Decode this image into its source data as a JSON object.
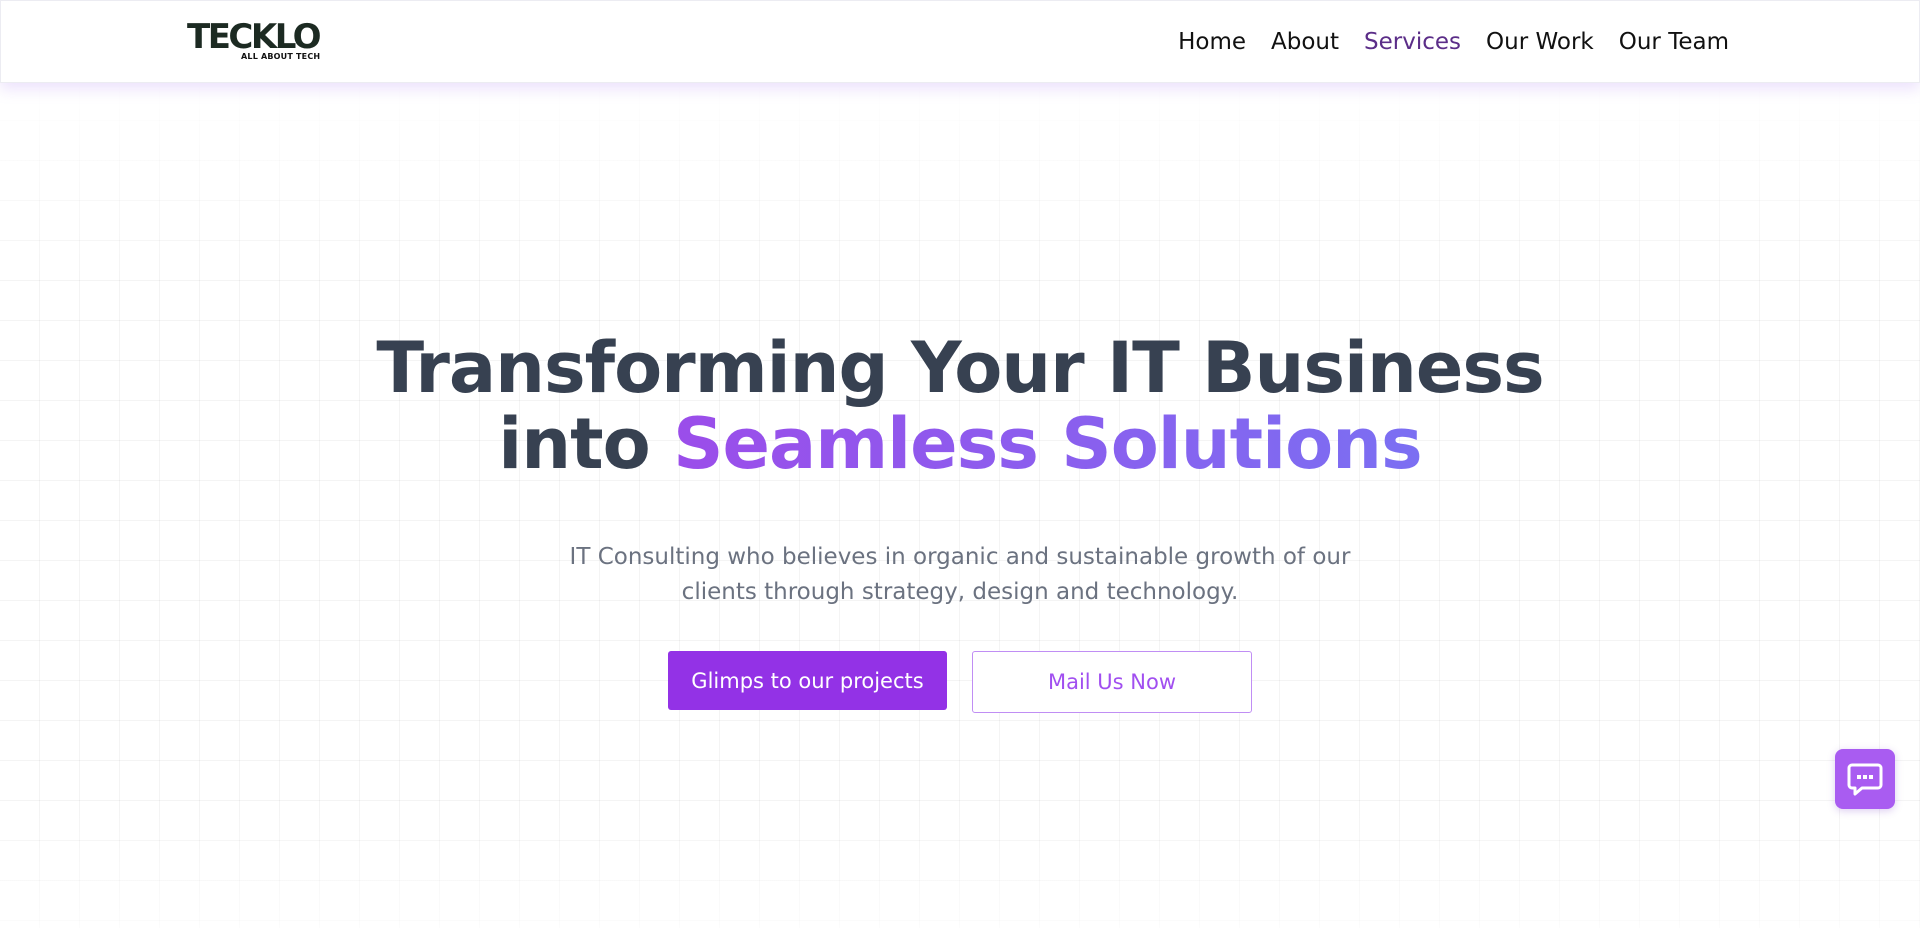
{
  "brand": {
    "logo_text": "TECKLO",
    "tagline": "ALL ABOUT TECH"
  },
  "nav": {
    "items": [
      {
        "label": "Home"
      },
      {
        "label": "About"
      },
      {
        "label": "Services",
        "active": true
      },
      {
        "label": "Our Work"
      },
      {
        "label": "Our Team"
      }
    ]
  },
  "hero": {
    "title_line1": "Transforming Your IT Business",
    "title_line2_prefix": "into",
    "title_highlight": "Seamless Solutions",
    "subtitle_line1": "IT Consulting who believes in organic and sustainable growth of our",
    "subtitle_line2": "clients through strategy, design and technology.",
    "primary_button": "Glimps to our projects",
    "secondary_button": "Mail Us Now"
  },
  "chat": {
    "icon": "chat-bubble-icon"
  },
  "colors": {
    "accent": "#9332e6",
    "gradient_start": "#9b4dea",
    "gradient_end": "#7b6ff2",
    "nav_active": "#5b2d88",
    "heading": "#374151",
    "body_text": "#6b7280"
  }
}
